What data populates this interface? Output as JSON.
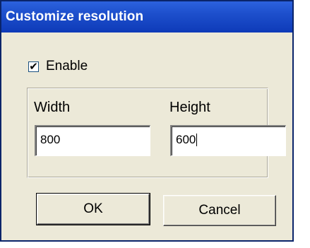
{
  "dialog": {
    "title": "Customize resolution"
  },
  "enable": {
    "label": "Enable",
    "checked": true,
    "check_glyph": "✔"
  },
  "width": {
    "label": "Width",
    "value": "800"
  },
  "height": {
    "label": "Height",
    "value": "600"
  },
  "buttons": {
    "ok_label": "OK",
    "cancel_label": "Cancel"
  },
  "colors": {
    "titlebar": "#1d4fcc",
    "dialog_bg": "#ece9d8",
    "border": "#0a246a"
  }
}
